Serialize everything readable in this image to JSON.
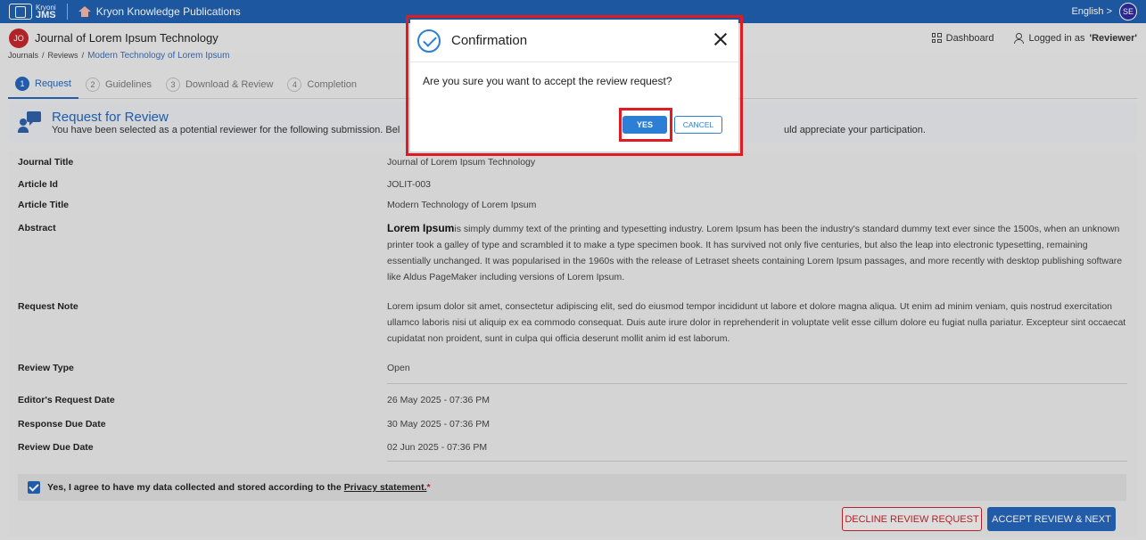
{
  "header": {
    "logo_small": "Kryoni",
    "logo_big": "JMS",
    "publication": "Kryon Knowledge Publications",
    "language": "English >",
    "user_initials": "SE"
  },
  "journal_bar": {
    "badge": "JO",
    "title": "Journal of Lorem Ipsum Technology",
    "dashboard": "Dashboard",
    "logged_in_prefix": "Logged in as",
    "logged_in_role": "'Reviewer'"
  },
  "breadcrumb": [
    "Journals",
    "/",
    "Reviews",
    "/",
    "Modern Technology of Lorem Ipsum"
  ],
  "steps": [
    {
      "num": "1",
      "label": "Request"
    },
    {
      "num": "2",
      "label": "Guidelines"
    },
    {
      "num": "3",
      "label": "Download & Review"
    },
    {
      "num": "4",
      "label": "Completion"
    }
  ],
  "request_card": {
    "title": "Request for Review",
    "desc_left": "You have been selected as a potential reviewer for the following submission. Bel",
    "desc_right": "uld appreciate your participation."
  },
  "details": {
    "journal_title_label": "Journal Title",
    "journal_title": "Journal of Lorem Ipsum Technology",
    "article_id_label": "Article Id",
    "article_id": "JOLIT-003",
    "article_title_label": "Article Title",
    "article_title": "Modern Technology of Lorem Ipsum",
    "abstract_label": "Abstract",
    "abstract_lead": "Lorem Ipsum",
    "abstract_text": "is simply dummy text of the printing and typesetting industry. Lorem Ipsum has been the industry's standard dummy text ever since the 1500s, when an unknown printer took a galley of type and scrambled it to make a type specimen book. It has survived not only five centuries, but also the leap into electronic typesetting, remaining essentially unchanged. It was popularised in the 1960s with the release of Letraset sheets containing Lorem Ipsum passages, and more recently with desktop publishing software like Aldus PageMaker including versions of Lorem Ipsum.",
    "request_note_label": "Request Note",
    "request_note": "Lorem ipsum dolor sit amet, consectetur adipiscing elit, sed do eiusmod tempor incididunt ut labore et dolore magna aliqua. Ut enim ad minim veniam, quis nostrud exercitation ullamco laboris nisi ut aliquip ex ea commodo consequat. Duis aute irure dolor in reprehenderit in voluptate velit esse cillum dolore eu fugiat nulla pariatur. Excepteur sint occaecat cupidatat non proident, sunt in culpa qui officia deserunt mollit anim id est laborum.",
    "review_type_label": "Review Type",
    "review_type": "Open",
    "editor_request_date_label": "Editor's Request Date",
    "editor_request_date": "26 May 2025 - 07:36 PM",
    "response_due_date_label": "Response Due Date",
    "response_due_date": "30 May 2025 - 07:36 PM",
    "review_due_date_label": "Review Due Date",
    "review_due_date": "02 Jun 2025 - 07:36 PM"
  },
  "consent": {
    "text": "Yes, I agree to have my data collected and stored according to the",
    "link": "Privacy statement.",
    "required_mark": "*",
    "checked": true
  },
  "actions": {
    "decline": "DECLINE REVIEW REQUEST",
    "accept": "ACCEPT REVIEW & NEXT"
  },
  "modal": {
    "title": "Confirmation",
    "message": "Are you sure you want to accept the review request?",
    "yes": "YES",
    "cancel": "CANCEL"
  },
  "colors": {
    "brand_blue": "#1f5fae",
    "primary": "#2564b8",
    "danger": "#c0262b",
    "highlight": "#e01b22"
  }
}
